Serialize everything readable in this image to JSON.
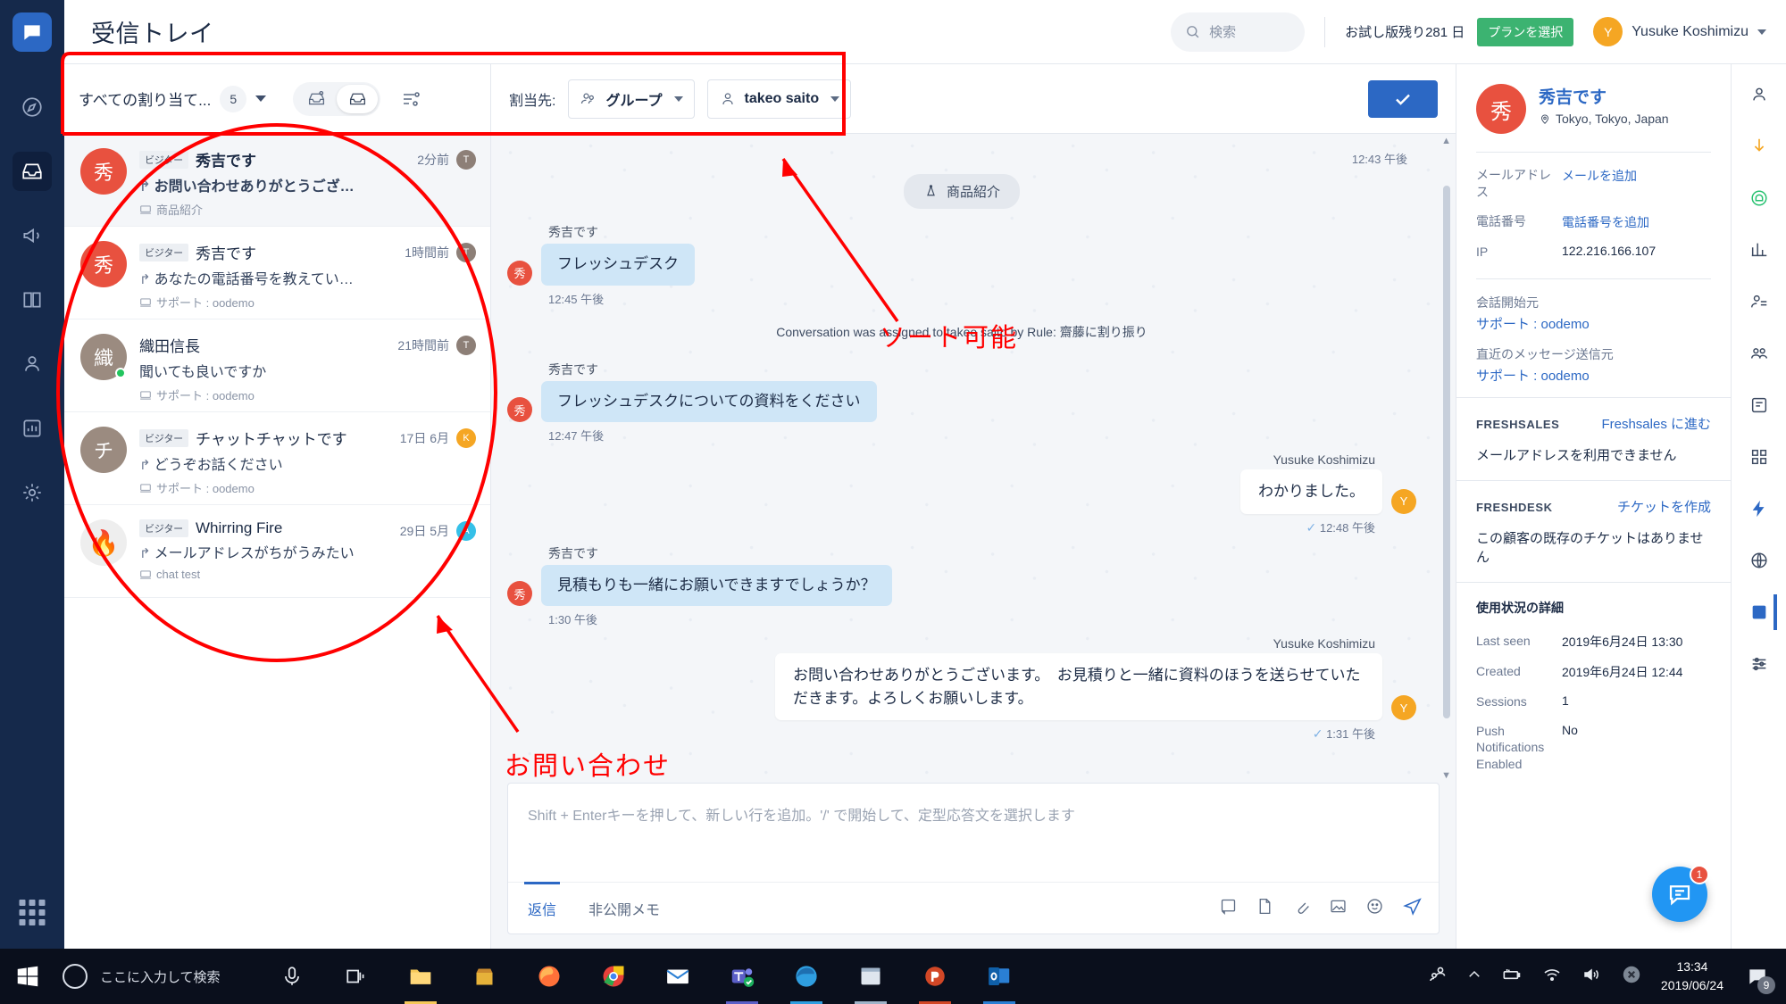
{
  "header": {
    "page_title": "受信トレイ",
    "search_placeholder": "検索",
    "trial_text": "お試し版残り281 日",
    "plan_button": "プランを選択",
    "user_name": "Yusuke Koshimizu",
    "user_initial": "Y"
  },
  "list_toolbar": {
    "filter_label": "すべての割り当て...",
    "count": "5"
  },
  "conversations": [
    {
      "initial": "秀",
      "av_color": "#e8513f",
      "tag": "ビジター",
      "name": "秀吉です",
      "preview": "お問い合わせありがとうござい...",
      "channel": "商品紹介",
      "time": "2分前",
      "agent": "T",
      "agent_color": "#8d7f77",
      "selected": true,
      "online": false
    },
    {
      "initial": "秀",
      "av_color": "#e8513f",
      "tag": "ビジター",
      "name": "秀吉です",
      "preview": "あなたの電話番号を教えていた...",
      "channel": "サポート : oodemo",
      "time": "1時間前",
      "agent": "T",
      "agent_color": "#8d7f77",
      "selected": false,
      "online": false
    },
    {
      "initial": "織",
      "av_color": "#9b8b80",
      "tag": "",
      "name": "織田信長",
      "preview": "聞いても良いですか",
      "channel": "サポート : oodemo",
      "time": "21時間前",
      "agent": "T",
      "agent_color": "#8d7f77",
      "selected": false,
      "online": true
    },
    {
      "initial": "チ",
      "av_color": "#9b8b80",
      "tag": "ビジター",
      "name": "チャットチャットです",
      "preview": "どうぞお話ください",
      "channel": "サポート : oodemo",
      "time": "17日 6月",
      "agent": "K",
      "agent_color": "#f5a623",
      "selected": false,
      "online": false
    },
    {
      "initial": "🔥",
      "av_color": "#eeeeee",
      "tag": "ビジター",
      "name": "Whirring Fire",
      "preview": "メールアドレスがちがうみたい",
      "channel": "chat test",
      "time": "29日 5月",
      "agent": "A",
      "agent_color": "#35c0e8",
      "selected": false,
      "online": false
    }
  ],
  "chat_header": {
    "assign_label": "割当先:",
    "group_value": "グループ",
    "agent_value": "takeo saito"
  },
  "chat": {
    "top_timestamp": "12:43 午後",
    "product_chip": "商品紹介",
    "system_note": "Conversation was assigned to takeo saito by Rule: 齋藤に割り振り",
    "messages": [
      {
        "dir": "in",
        "who": "秀吉です",
        "avatar": "秀",
        "text": "フレッシュデスク",
        "time": "12:45 午後"
      },
      {
        "dir": "in",
        "who": "秀吉です",
        "avatar": "秀",
        "text": "フレッシュデスクについての資料をください",
        "time": "12:47 午後"
      },
      {
        "dir": "out",
        "who": "Yusuke Koshimizu",
        "avatar": "Y",
        "text": "わかりました。",
        "time": "12:48 午後"
      },
      {
        "dir": "in",
        "who": "秀吉です",
        "avatar": "秀",
        "text": "見積もりも一緒にお願いできますでしょうか？",
        "time": "1:30 午後"
      },
      {
        "dir": "out",
        "who": "Yusuke Koshimizu",
        "avatar": "Y",
        "text": "お問い合わせありがとうございます。　お見積りと一緒に資料のほうを送らせていただきます。よろしくお願いします。",
        "time": "1:31 午後"
      }
    ]
  },
  "composer": {
    "placeholder": "Shift + Enterキーを押して、新しい行を追加。'/' で開始して、定型応答文を選択します",
    "tab_reply": "返信",
    "tab_note": "非公開メモ"
  },
  "contact": {
    "initial": "秀",
    "name": "秀吉です",
    "location": "Tokyo, Tokyo, Japan",
    "fields": [
      {
        "key": "メールアドレス",
        "value": "メールを追加",
        "link": true
      },
      {
        "key": "電話番号",
        "value": "電話番号を追加",
        "link": true
      },
      {
        "key": "IP",
        "value": "122.216.166.107",
        "link": false
      }
    ],
    "source_label": "会話開始元",
    "source_value": "サポート : oodemo",
    "last_label": "直近のメッセージ送信元",
    "last_value": "サポート : oodemo",
    "freshsales": {
      "title": "FRESHSALES",
      "action": "Freshsales に進む",
      "body": "メールアドレスを利用できません"
    },
    "freshdesk": {
      "title": "FRESHDESK",
      "action": "チケットを作成",
      "body": "この顧客の既存のチケットはありません"
    },
    "usage": {
      "title": "使用状況の詳細",
      "rows": [
        {
          "key": "Last seen",
          "value": "2019年6月24日 13:30"
        },
        {
          "key": "Created",
          "value": "2019年6月24日 12:44"
        },
        {
          "key": "Sessions",
          "value": "1"
        },
        {
          "key": "Push Notifications Enabled",
          "value": "No"
        }
      ]
    },
    "fab_badge": "1"
  },
  "annotations": {
    "sort_text": "ソート可能",
    "inquiry_text": "お問い合わせ"
  },
  "taskbar": {
    "search_placeholder": "ここに入力して検索",
    "clock_time": "13:34",
    "clock_date": "2019/06/24",
    "notif_count": "9"
  },
  "colors": {
    "accent": "#2c68c4",
    "rail_bg": "#15294b",
    "green": "#3cb371",
    "red_anno": "#ff0000"
  }
}
